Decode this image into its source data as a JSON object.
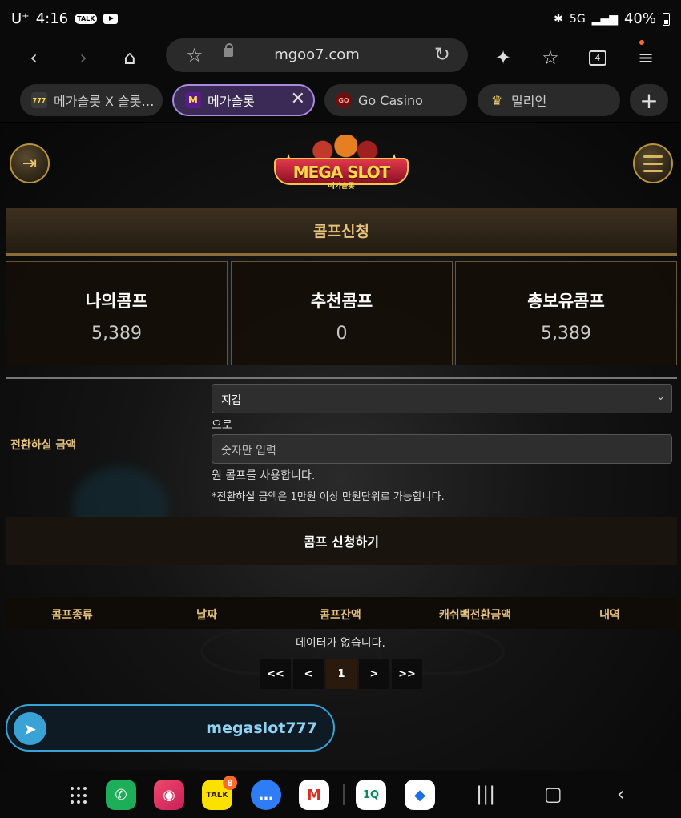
{
  "status_bar": {
    "carrier": "U⁺",
    "time": "4:16",
    "talk_badge": "TALK",
    "signal": "5G",
    "battery": "40%"
  },
  "browser": {
    "url": "mgoo7.com",
    "tab_count": "4"
  },
  "tabs": [
    {
      "label": "메가슬롯 X 슬롯…",
      "favicon": "slot-machine-icon",
      "fav_text": "777"
    },
    {
      "label": "메가슬롯",
      "favicon": "m-logo-icon",
      "fav_text": "M"
    },
    {
      "label": "Go Casino",
      "favicon": "go-casino-icon",
      "fav_text": "GO"
    },
    {
      "label": "밀리언",
      "favicon": "crown-icon",
      "fav_text": "♛"
    }
  ],
  "site": {
    "logo_text": "MEGA SLOT",
    "logo_sub": "메가슬롯"
  },
  "section_title": "콤프신청",
  "stats": [
    {
      "label": "나의콤프",
      "value": "5,389"
    },
    {
      "label": "추천콤프",
      "value": "0"
    },
    {
      "label": "총보유콤프",
      "value": "5,389"
    }
  ],
  "form": {
    "label": "전환하실 금액",
    "select_value": "지갑",
    "suffix": "으로",
    "input_placeholder": "숫자만 입력",
    "usage_text": "원 콤프를 사용합니다.",
    "note": "*전환하실 금액은 1만원 이상 만원단위로 가능합니다.",
    "submit_label": "콤프 신청하기"
  },
  "table": {
    "headers": [
      "콤프종류",
      "날짜",
      "콤프잔액",
      "캐쉬백전환금액",
      "내역"
    ],
    "empty_message": "데이터가 없습니다."
  },
  "pagination": {
    "first": "<<",
    "prev": "<",
    "current": "1",
    "next": ">",
    "last": ">>"
  },
  "telegram": {
    "handle": "megaslot777"
  },
  "navbar": {
    "kakao_label": "TALK",
    "kakao_badge": "8",
    "onei_label": "1Q"
  },
  "colors": {
    "accent_gold": "#e6c27a",
    "active_tab": "#a98be0",
    "telegram": "#3aa3d6"
  }
}
